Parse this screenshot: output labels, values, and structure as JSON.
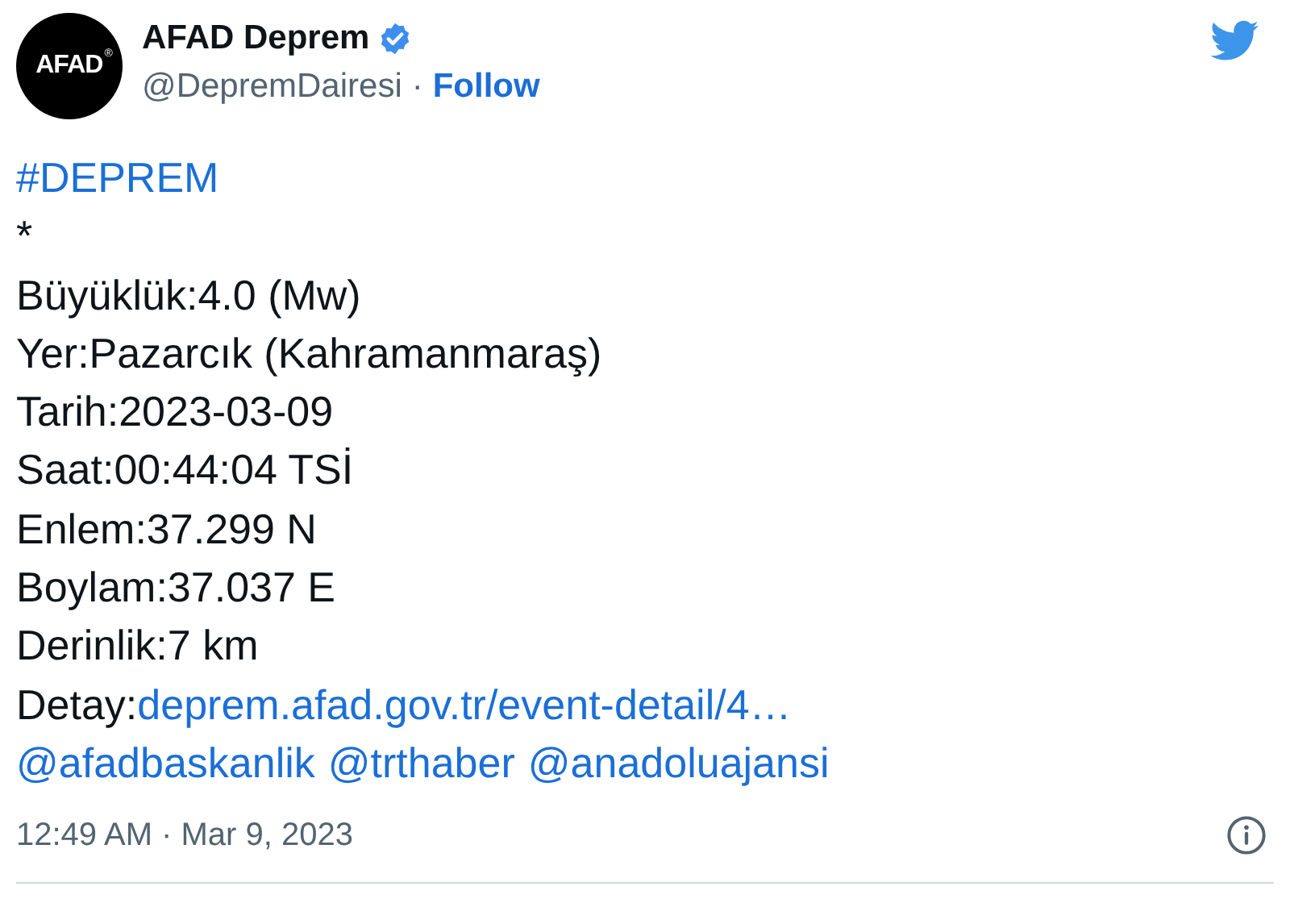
{
  "author": {
    "logo_text": "AFAD",
    "logo_mark": "®",
    "name": "AFAD Deprem",
    "verified": true,
    "handle": "@DepremDairesi",
    "separator": "·",
    "follow": "Follow"
  },
  "body": [
    {
      "kind": "link",
      "text": "#DEPREM"
    },
    {
      "kind": "text",
      "text": "*"
    },
    {
      "kind": "text",
      "text": "Büyüklük:4.0 (Mw)"
    },
    {
      "kind": "text",
      "text": "Yer:Pazarcık (Kahramanmaraş)"
    },
    {
      "kind": "text",
      "text": "Tarih:2023-03-09"
    },
    {
      "kind": "text",
      "text": "Saat:00:44:04 TSİ"
    },
    {
      "kind": "text",
      "text": "Enlem:37.299 N"
    },
    {
      "kind": "text",
      "text": "Boylam:37.037 E"
    },
    {
      "kind": "text",
      "text": "Derinlik:7 km"
    },
    {
      "kind": "detail",
      "label": "Detay:",
      "link": "deprem.afad.gov.tr/event-detail/4…"
    },
    {
      "kind": "mentions",
      "links": [
        "@afadbaskanlik",
        "@trthaber",
        "@anadoluajansi"
      ]
    }
  ],
  "timestamp": "12:49 AM · Mar 9, 2023"
}
